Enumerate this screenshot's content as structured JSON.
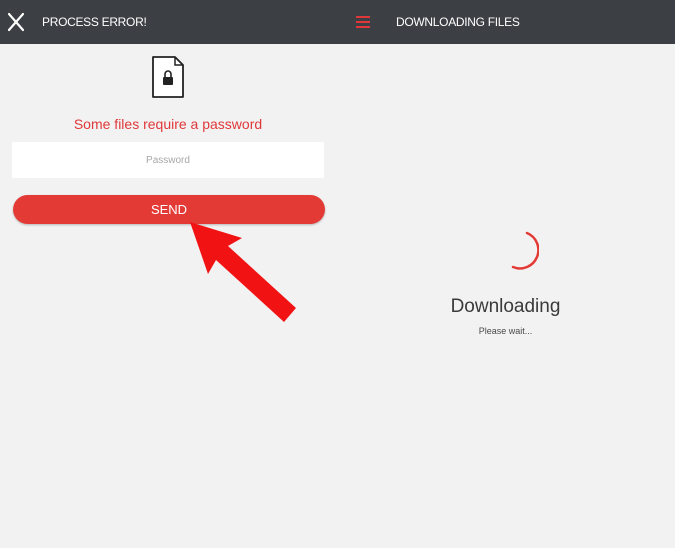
{
  "header": {
    "left_title": "PROCESS ERROR!",
    "right_title": "DOWNLOADING FILES"
  },
  "password_panel": {
    "message": "Some files require a password",
    "input_placeholder": "Password",
    "input_value": "",
    "send_label": "SEND"
  },
  "download_panel": {
    "status_title": "Downloading",
    "status_subtitle": "Please wait..."
  },
  "icons": [
    "close-icon",
    "menu-icon",
    "locked-file-icon",
    "loading-spinner-icon",
    "red-pointer-arrow"
  ],
  "colors": {
    "topbar": "#3c3f43",
    "accent": "#e43a36",
    "background": "#f2f2f2"
  }
}
